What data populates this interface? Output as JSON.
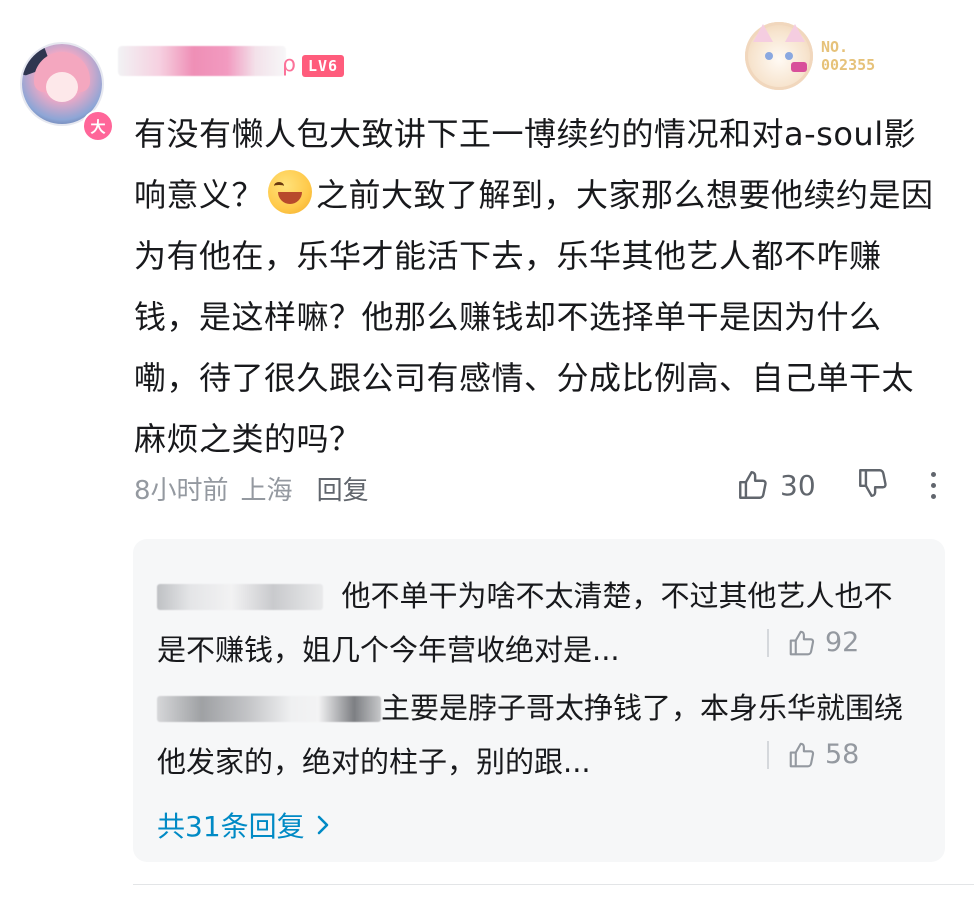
{
  "comment": {
    "level_label": "LV6",
    "username_tail": "ρ",
    "avatar_badge": "大",
    "decoration_number": "NO.\n002355",
    "text_before_emoji": "有没有懒人包大致讲下王一博续约的情况和对a-soul影响意义？",
    "text_after_emoji": "之前大致了解到，大家那么想要他续约是因为有他在，乐华才能活下去，乐华其他艺人都不咋赚钱，是这样嘛？他那么赚钱却不选择单干是因为什么嘞，待了很久跟公司有感情、分成比例高、自己单干太麻烦之类的吗？",
    "time": "8小时前",
    "location": "上海",
    "reply_label": "回复",
    "like_count": "30"
  },
  "replies": [
    {
      "text": "他不单干为啥不太清楚，不过其他艺人也不是不赚钱，姐几个今年营收绝对是...",
      "like_count": "92"
    },
    {
      "text": "主要是脖子哥太挣钱了，本身乐华就围绕他发家的，绝对的柱子，别的跟...",
      "like_count": "58"
    }
  ],
  "view_all_label": "共31条回复",
  "colors": {
    "link": "#008ac5",
    "level_badge": "#ff5c7c",
    "muted": "#9499a0",
    "reply_bg": "#f6f7f8"
  }
}
